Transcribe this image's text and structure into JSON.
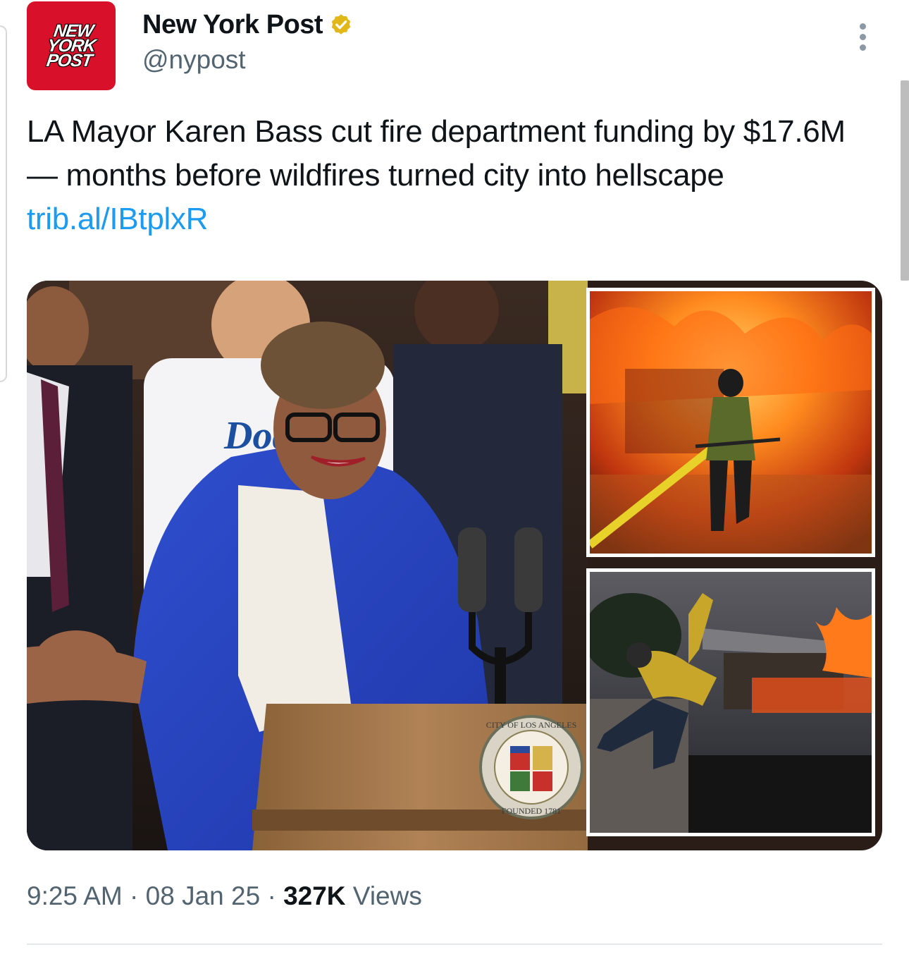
{
  "account": {
    "display_name": "New York Post",
    "handle": "@nypost",
    "verified": true,
    "verified_badge_color": "#e2b719",
    "avatar": {
      "logo_lines": [
        "NEW",
        "YORK",
        "POST"
      ],
      "background_color": "#d8102a"
    },
    "more_icon": "more-vertical-icon"
  },
  "tweet": {
    "text": "LA Mayor Karen Bass cut fire department funding by $17.6M — months before wildfires turned city into hellscape",
    "link_text": "trib.al/IBtplxR",
    "link_color": "#1d9bf0"
  },
  "media": {
    "main_photo_text": {
      "jersey": "Dodgers",
      "seal_top": "CITY OF LOS ANGELES",
      "seal_bottom": "FOUNDED 1781"
    }
  },
  "meta": {
    "time": "9:25 AM",
    "separator": " · ",
    "date": "08 Jan 25",
    "views_count": "327K",
    "views_label": " Views"
  }
}
